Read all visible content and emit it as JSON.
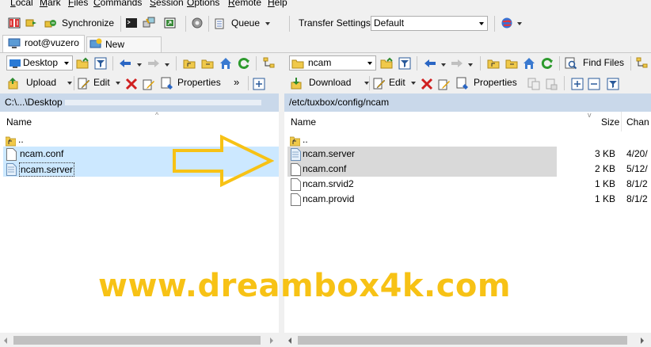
{
  "menu": [
    "Local",
    "Mark",
    "Files",
    "Commands",
    "Session",
    "Options",
    "Remote",
    "Help"
  ],
  "toolbar": {
    "synchronize_label": "Synchronize",
    "queue_label": "Queue",
    "transfer_settings_label": "Transfer Settings",
    "transfer_settings_value": "Default"
  },
  "tabs": {
    "session_label": "root@vuzero",
    "new_session_label": "New Session"
  },
  "left": {
    "location": "Desktop",
    "upload_label": "Upload",
    "edit_label": "Edit",
    "properties_label": "Properties",
    "more": "»",
    "path": "C:\\...\\Desktop",
    "col_name": "Name",
    "parent": "..",
    "files": [
      "ncam.conf",
      "ncam.server"
    ]
  },
  "right": {
    "location": "ncam",
    "find_files_label": "Find Files",
    "download_label": "Download",
    "edit_label": "Edit",
    "properties_label": "Properties",
    "path": "/etc/tuxbox/config/ncam",
    "col_name": "Name",
    "col_size": "Size",
    "col_changed": "Chan",
    "parent": "..",
    "files": [
      {
        "name": "ncam.server",
        "size": "3 KB",
        "changed": "4/20/"
      },
      {
        "name": "ncam.conf",
        "size": "2 KB",
        "changed": "5/12/"
      },
      {
        "name": "ncam.srvid2",
        "size": "1 KB",
        "changed": "8/1/2"
      },
      {
        "name": "ncam.provid",
        "size": "1 KB",
        "changed": "8/1/2"
      }
    ]
  },
  "watermark": "www.dreambox4k.com",
  "colors": {
    "path_bar": "#c9d8ea",
    "selection_blue": "#cce8ff",
    "selection_gray": "#d9d9d9",
    "arrow_yellow": "#f7c215"
  }
}
